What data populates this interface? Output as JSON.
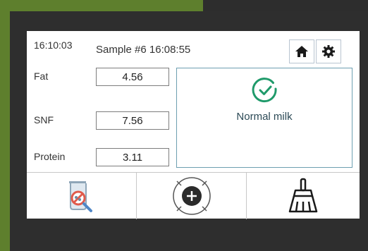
{
  "header": {
    "clock": "16:10:03",
    "sample": "Sample #6 16:08:55"
  },
  "icons": {
    "home": "home-icon",
    "settings": "gear-icon",
    "status": "check-circle-icon",
    "analyze": "beaker-magnifier-icon",
    "add": "add-crosshair-icon",
    "clean": "brush-icon"
  },
  "measurements": [
    {
      "label": "Fat",
      "value": "4.56"
    },
    {
      "label": "SNF",
      "value": "7.56"
    },
    {
      "label": "Protein",
      "value": "3.11"
    }
  ],
  "status": {
    "text": "Normal milk",
    "color": "#1f9a6a"
  },
  "colors": {
    "bezel_green": "#5e7f2d",
    "bezel_dark": "#2e2e2e",
    "panel_border": "#6d9fb1"
  }
}
